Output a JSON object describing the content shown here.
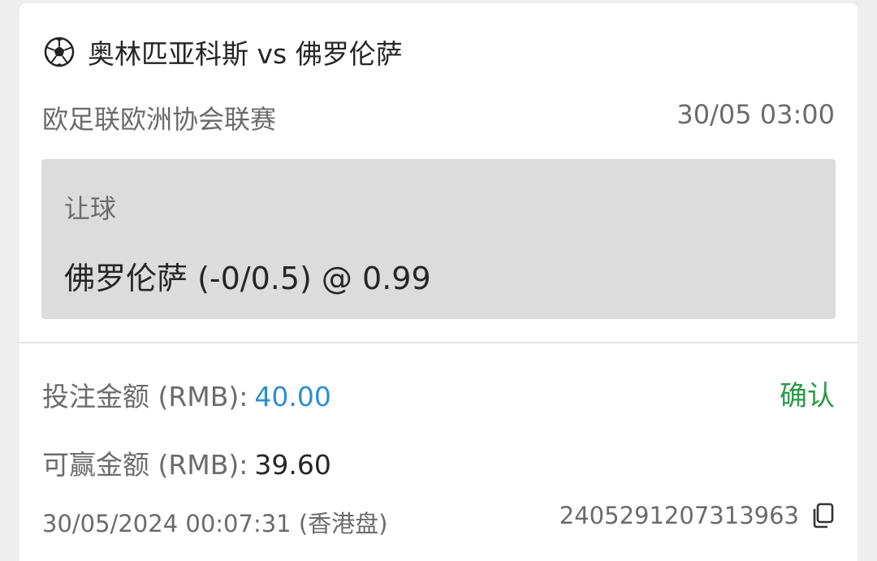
{
  "match": {
    "title": "奥林匹亚科斯 vs 佛罗伦萨",
    "icon": "soccer-ball-icon",
    "league": "欧足联欧洲协会联赛",
    "kickoff": "30/05 03:00"
  },
  "bet": {
    "market": "让球",
    "selection": "佛罗伦萨 (-0/0.5) @ 0.99"
  },
  "stake": {
    "label": "投注金额 (RMB):",
    "value": "40.00"
  },
  "winnings": {
    "label": "可赢金额 (RMB):",
    "value": "39.60"
  },
  "confirm_label": "确认",
  "footer": {
    "placed_time": "30/05/2024 00:07:31 (香港盘)",
    "reference": "2405291207313963",
    "copy_icon": "copy-icon"
  },
  "colors": {
    "stake_value": "#2d8fcf",
    "confirm": "#2a9a48",
    "bet_box": "#dcdcdc"
  }
}
